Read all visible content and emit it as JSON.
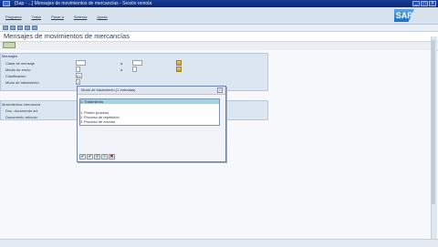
{
  "window": {
    "title": "[Sap - ...] Mensajes de movimientos de mercancías - Sesión remota"
  },
  "menu": {
    "items": [
      "Programa",
      "Tratar",
      "Pasar a",
      "Sistema",
      "Ayuda"
    ]
  },
  "logo_text": "SAP",
  "screen": {
    "title": "Mensajes de movimientos de mercancías"
  },
  "messages_group": {
    "title": "Mensajes",
    "rows": [
      {
        "label": "Clase de mensaje",
        "sep": "a"
      },
      {
        "label": "Medio de envío",
        "sep": "a"
      },
      {
        "label": "Clasificación",
        "value": "01"
      },
      {
        "label": "Modo de tratamiento",
        "value": "1"
      }
    ]
  },
  "movements_group": {
    "title": "Movimientos mercancía",
    "rows": [
      {
        "label": "Doc. documento art."
      },
      {
        "label": "Documento artículo"
      }
    ]
  },
  "popup": {
    "title": "Modo de tratamiento (1 entradas)",
    "items": [
      {
        "num": "1",
        "label": "Tratamiento",
        "selected": true
      },
      {
        "num": "",
        "label": "",
        "selected": false
      },
      {
        "num": "1",
        "label": "Primer proceso",
        "selected": false
      },
      {
        "num": "2",
        "label": "Proceso de repetición",
        "selected": false
      },
      {
        "num": "3",
        "label": "Proceso de errores",
        "selected": false
      }
    ],
    "buttons": [
      "✔",
      "✔",
      "⚲",
      "⇳",
      "✖"
    ]
  },
  "accent_color": "#1a3f9a",
  "selection_color": "#9fd4e3"
}
